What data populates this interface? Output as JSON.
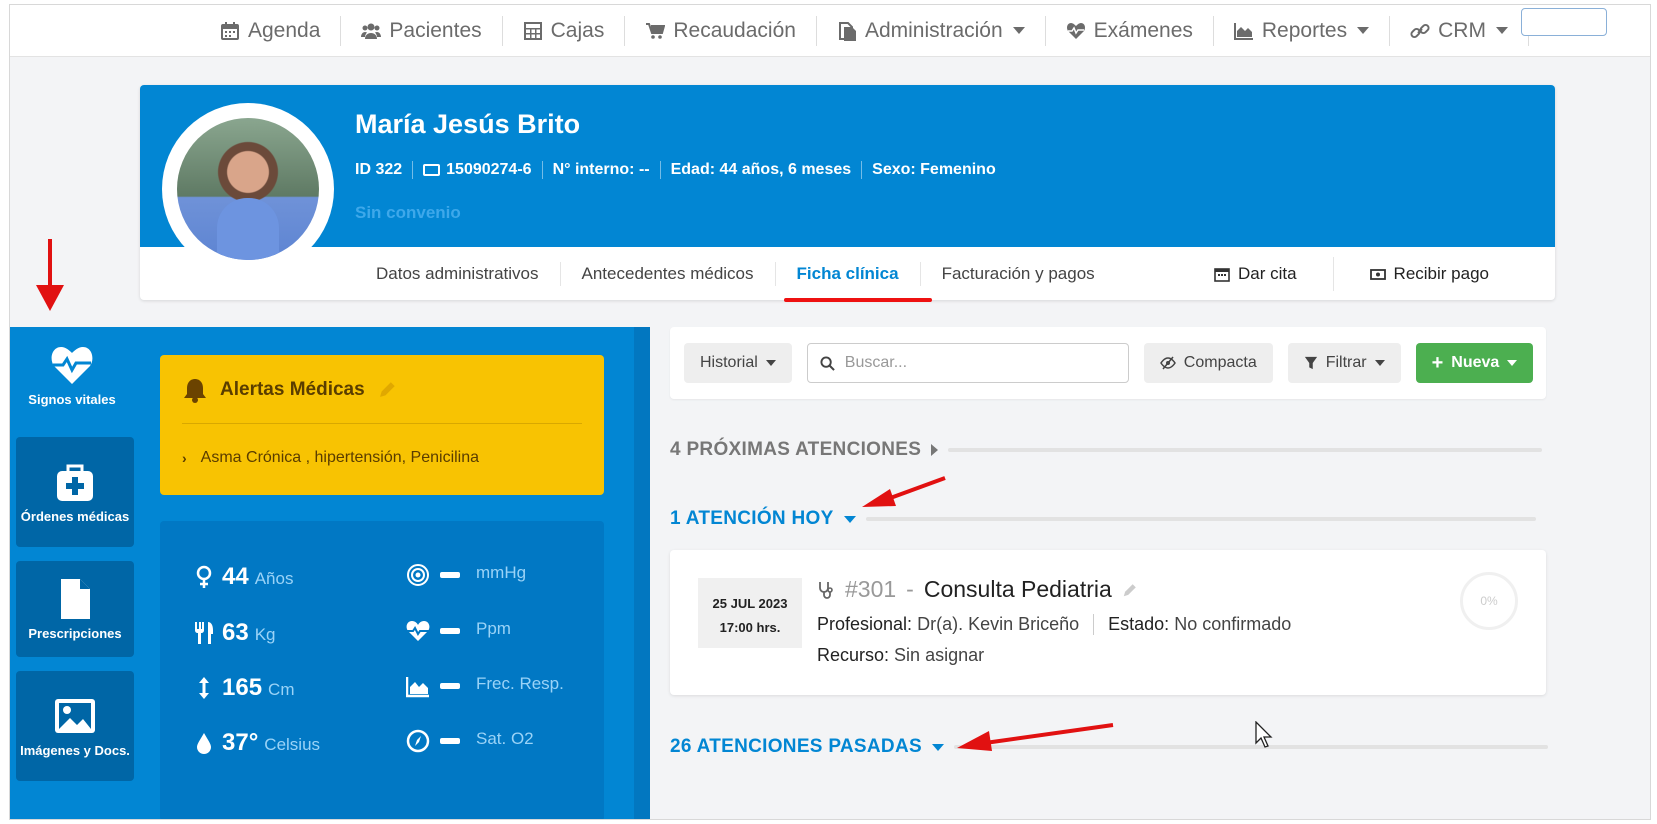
{
  "nav": {
    "items": [
      {
        "label": "Agenda",
        "icon": "calendar-icon"
      },
      {
        "label": "Pacientes",
        "icon": "users-icon"
      },
      {
        "label": "Cajas",
        "icon": "calculator-icon"
      },
      {
        "label": "Recaudación",
        "icon": "cart-icon"
      },
      {
        "label": "Administración",
        "icon": "copy-icon"
      },
      {
        "label": "Exámenes",
        "icon": "heartbeat-icon"
      },
      {
        "label": "Reportes",
        "icon": "area-chart-icon"
      },
      {
        "label": "CRM",
        "icon": "link-icon"
      }
    ]
  },
  "patient": {
    "name": "María Jesús Brito",
    "id": "ID 322",
    "rut": "15090274-6",
    "internal": "N° interno: --",
    "age": "Edad: 44 años, 6 meses",
    "sex": "Sexo: Femenino",
    "convenio": "Sin convenio"
  },
  "tabs": [
    "Datos administrativos",
    "Antecedentes médicos",
    "Ficha clínica",
    "Facturación y pagos"
  ],
  "actions": {
    "dar_cita": "Dar cita",
    "recibir_pago": "Recibir pago"
  },
  "side_tabs": [
    "Signos vitales",
    "Órdenes médicas",
    "Prescripciones",
    "Imágenes y Docs."
  ],
  "alerts": {
    "title": "Alertas Médicas",
    "items": "Asma Crónica , hipertensión, Penicilina"
  },
  "vitals": {
    "age": {
      "value": "44",
      "unit": "Años"
    },
    "weight": {
      "value": "63",
      "unit": "Kg"
    },
    "height": {
      "value": "165",
      "unit": "Cm"
    },
    "temp": {
      "value": "37°",
      "unit": "Celsius"
    },
    "pressure": {
      "unit": "mmHg"
    },
    "pulse": {
      "unit": "Ppm"
    },
    "resp": {
      "unit": "Frec. Resp."
    },
    "sat": {
      "unit": "Sat. O2"
    }
  },
  "toolbar": {
    "historial": "Historial",
    "search_placeholder": "Buscar...",
    "compacta": "Compacta",
    "filtrar": "Filtrar",
    "nueva": "Nueva"
  },
  "sections": {
    "proximas": "4 PRÓXIMAS ATENCIONES",
    "hoy": "1 ATENCIÓN HOY",
    "pasadas": "26 ATENCIONES PASADAS"
  },
  "appointment": {
    "date": "25 JUL 2023",
    "time": "17:00 hrs.",
    "number": "#301",
    "title": "Consulta Pediatria",
    "professional_label": "Profesional:",
    "professional": "Dr(a). Kevin Briceño",
    "status_label": "Estado:",
    "status": "No confirmado",
    "resource_label": "Recurso:",
    "resource": "Sin asignar",
    "progress": "0%"
  },
  "colors": {
    "primary": "#0286d3",
    "alert": "#f8c302",
    "new_button": "#4caf50",
    "annotation_red": "#e11111"
  }
}
